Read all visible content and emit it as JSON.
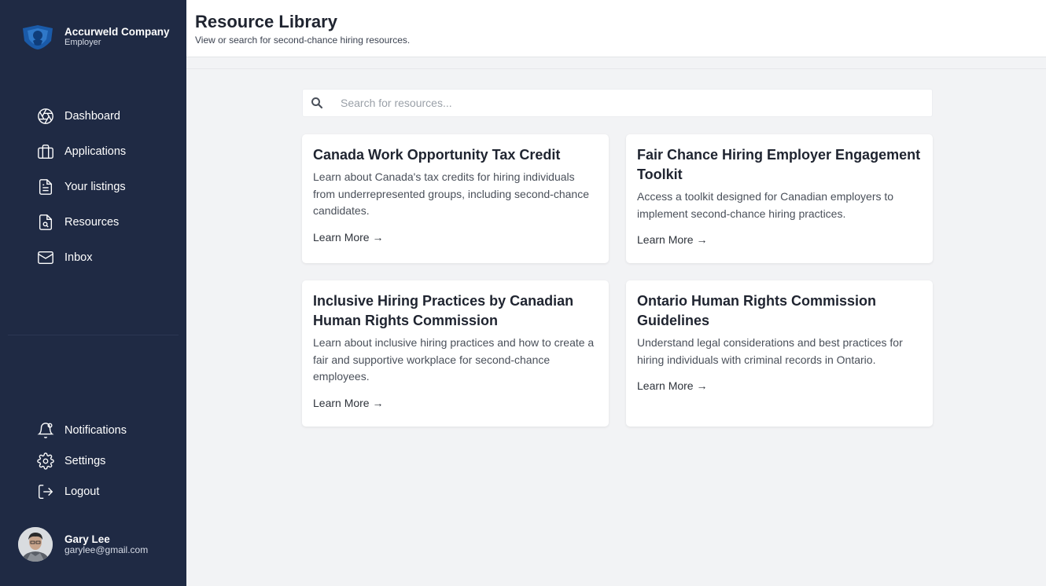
{
  "brand": {
    "company": "Accurweld Company",
    "role": "Employer"
  },
  "nav": {
    "main": [
      {
        "label": "Dashboard",
        "icon": "aperture-icon"
      },
      {
        "label": "Applications",
        "icon": "briefcase-icon"
      },
      {
        "label": "Your listings",
        "icon": "document-icon"
      },
      {
        "label": "Resources",
        "icon": "document-search-icon"
      },
      {
        "label": "Inbox",
        "icon": "mail-icon"
      }
    ],
    "secondary": [
      {
        "label": "Notifications",
        "icon": "bell-icon"
      },
      {
        "label": "Settings",
        "icon": "gear-icon"
      },
      {
        "label": "Logout",
        "icon": "logout-icon"
      }
    ]
  },
  "user": {
    "name": "Gary Lee",
    "email": "garylee@gmail.com"
  },
  "header": {
    "title": "Resource Library",
    "subtitle": "View or search for second-chance hiring resources."
  },
  "search": {
    "placeholder": "Search for resources...",
    "value": ""
  },
  "cards": [
    {
      "title": "Canada Work Opportunity Tax Credit",
      "description": "Learn about Canada's tax credits for hiring individuals from underrepresented groups, including second-chance candidates.",
      "link": "Learn More →"
    },
    {
      "title": "Fair Chance Hiring Employer Engagement Toolkit",
      "description": "Access a toolkit designed for Canadian employers to implement second-chance hiring practices.",
      "link": "Learn More →"
    },
    {
      "title": "Inclusive Hiring Practices by Canadian Human Rights Commission",
      "description": "Learn about inclusive hiring practices and how to create a fair and supportive workplace for second-chance employees.",
      "link": "Learn More →"
    },
    {
      "title": "Ontario Human Rights Commission Guidelines",
      "description": "Understand legal considerations and best practices for hiring individuals with criminal records in Ontario.",
      "link": "Learn More →"
    }
  ],
  "colors": {
    "sidebar": "#1f2a44",
    "background": "#f2f3f5",
    "card": "#ffffff",
    "title_text": "#1f2430"
  }
}
